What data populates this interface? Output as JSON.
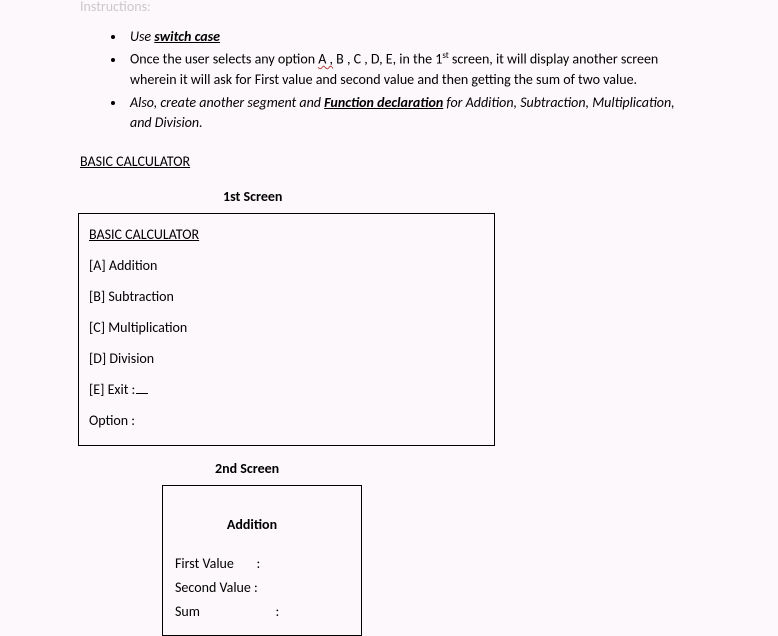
{
  "instructions_label": "Instructions:",
  "bullets": {
    "b1": {
      "prefix": "Use ",
      "kw": "switch case"
    },
    "b2": {
      "part1": "Once the user selects any option ",
      "wavy": "A ,",
      "part2": " B , C , D, E, in the 1",
      "sup": "st",
      "part3": " screen, it will display another screen wherein it will ask for First value and second value and then getting the sum of two value."
    },
    "b3": {
      "part1": "Also, create another segment and ",
      "kw": "Function declaration",
      "part2": " for Addition, Subtraction, Multiplication, and Division."
    }
  },
  "section_title": "BASIC CALCULATOR",
  "screen1": {
    "label": "1st Screen",
    "title": "BASIC CALCULATOR",
    "lineA": "[A] Addition",
    "lineB": "[B] Subtraction",
    "lineC": "[C] Multiplication",
    "lineD": "[D] Division",
    "lineE": "[E] Exit :",
    "option": "Option :"
  },
  "screen2": {
    "label": "2nd Screen",
    "title": "Addition",
    "line1": "First Value   :",
    "line2": "Second Value :",
    "line3": "Sum          :"
  }
}
